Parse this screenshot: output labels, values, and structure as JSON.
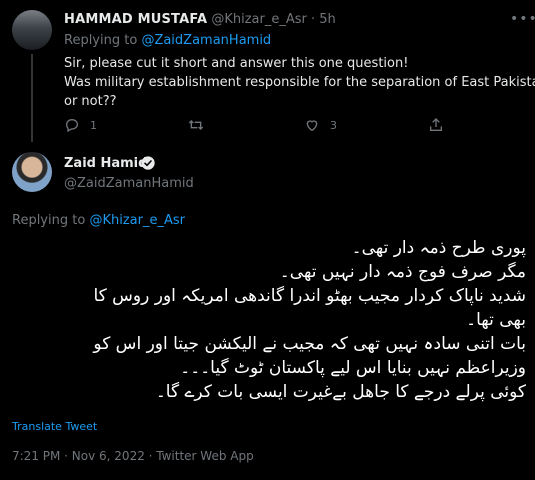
{
  "reply": {
    "name": "HAMMAD MUSTAFA",
    "handle_time": "@Khizar_e_Asr · 5h",
    "replying_prefix": "Replying to ",
    "replying_handle": "@ZaidZamanHamid",
    "text_lines": [
      "Sir, please cut it short and answer this one question!",
      "Was military establishment responsible for the separation of East Pakistan",
      "or not??"
    ],
    "actions": {
      "reply_count": "1",
      "retweet_count": "",
      "like_count": "3"
    }
  },
  "tweet": {
    "name": "Zaid Hamid",
    "handle": "@ZaidZamanHamid",
    "replying_prefix": "Replying to ",
    "replying_handle": "@Khizar_e_Asr",
    "text_lines": [
      "پوری طرح ذمہ دار تھی۔",
      "مگر صرف فوج ذمہ دار نہیں تھی۔",
      "شدید ناپاک کردار مجیب بھٹو اندرا گاندھی امریکہ اور روس کا",
      "بھی تھا۔",
      "بات اتنی سادہ نہیں تھی کہ مجیب نے الیکشن جیتا اور اس کو",
      "وزیراعظم نہیں بنایا اس لیے پاکستان ٹوٹ گیا۔۔۔",
      "کوئی پرلے درجے کا جاھل بےغیرت ایسی بات کرے گا۔"
    ],
    "translate_label": "Translate Tweet",
    "meta": "7:21 PM · Nov 6, 2022 · Twitter Web App"
  },
  "colors": {
    "background": "#000000",
    "text": "#e7e9ea",
    "muted": "#71767b",
    "accent": "#1d9bf0"
  },
  "icons": {
    "more": "more-icon",
    "reply": "reply-icon",
    "retweet": "retweet-icon",
    "like": "heart-icon",
    "share": "share-icon",
    "verified": "verified-badge-icon"
  }
}
